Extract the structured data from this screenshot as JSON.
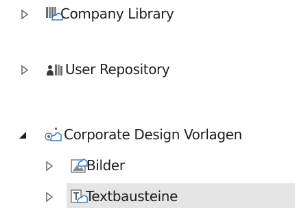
{
  "tree": {
    "items": [
      {
        "label": "Company Library",
        "state": "collapsed",
        "icon": "library-books-icon",
        "level": 0
      },
      {
        "label": "User Repository",
        "state": "collapsed",
        "icon": "user-repository-icon",
        "level": 0
      },
      {
        "label": "Corporate Design Vorlagen",
        "state": "expanded",
        "icon": "template-folder-icon",
        "level": 0
      },
      {
        "label": "Bilder",
        "state": "collapsed",
        "icon": "image-folder-icon",
        "level": 1
      },
      {
        "label": "Textbausteine",
        "state": "collapsed",
        "icon": "text-folder-icon",
        "level": 1,
        "selected": true
      }
    ]
  },
  "colors": {
    "selection": "#e5e5e5",
    "toggle": "#5a5a5a",
    "text": "#1e1e1e",
    "accent_blue": "#2f7fd3"
  }
}
